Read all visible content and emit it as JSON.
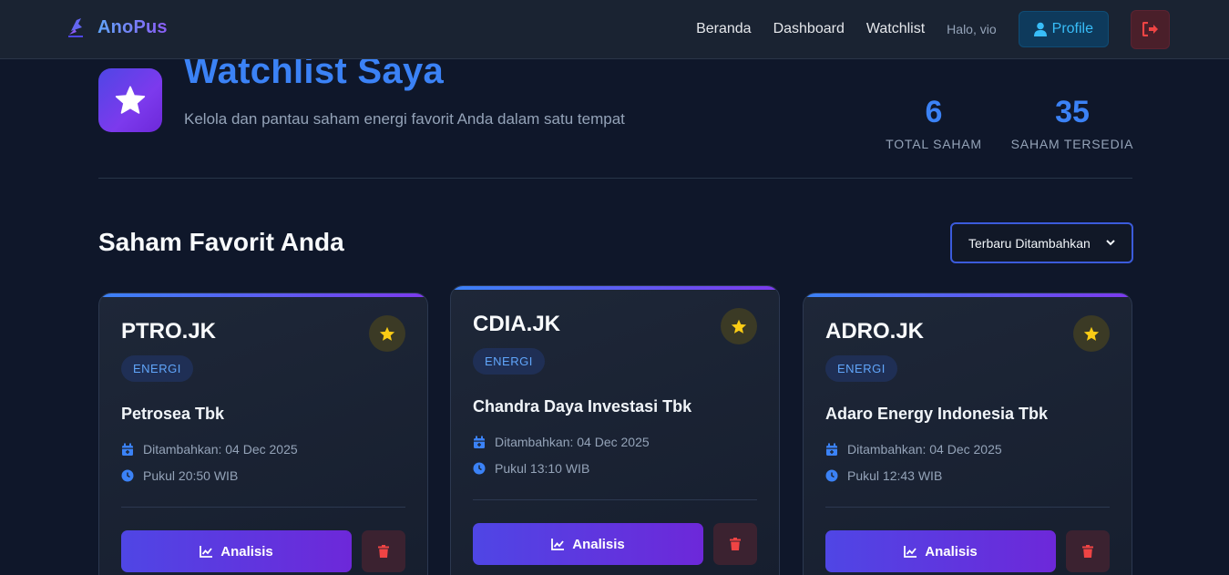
{
  "nav": {
    "brand": "AnoPus",
    "links": [
      "Beranda",
      "Dashboard",
      "Watchlist"
    ],
    "greeting": "Halo, vio",
    "profile_label": "Profile"
  },
  "header": {
    "title": "Watchlist Saya",
    "subtitle": "Kelola dan pantau saham energi favorit Anda dalam satu tempat",
    "stats": [
      {
        "value": "6",
        "label": "TOTAL SAHAM"
      },
      {
        "value": "35",
        "label": "SAHAM TERSEDIA"
      }
    ]
  },
  "section": {
    "title": "Saham Favorit Anda",
    "sort_selected": "Terbaru Ditambahkan"
  },
  "cards": [
    {
      "ticker": "PTRO.JK",
      "sector": "ENERGI",
      "company": "Petrosea Tbk",
      "added": "Ditambahkan: 04 Dec 2025",
      "time": "Pukul 20:50 WIB",
      "action": "Analisis"
    },
    {
      "ticker": "CDIA.JK",
      "sector": "ENERGI",
      "company": "Chandra Daya Investasi Tbk",
      "added": "Ditambahkan: 04 Dec 2025",
      "time": "Pukul 13:10 WIB",
      "action": "Analisis"
    },
    {
      "ticker": "ADRO.JK",
      "sector": "ENERGI",
      "company": "Adaro Energy Indonesia Tbk",
      "added": "Ditambahkan: 04 Dec 2025",
      "time": "Pukul 12:43 WIB",
      "action": "Analisis"
    }
  ],
  "colors": {
    "accent": "#3b82f6",
    "gradient_start": "#4f46e5",
    "gradient_end": "#7c3aed",
    "star": "#facc15",
    "danger": "#ef4444"
  },
  "icons": {
    "brand": "anopus-logo-icon",
    "profile": "user-icon",
    "logout": "sign-out-icon",
    "hero": "star-icon",
    "favorite": "star-icon",
    "date": "calendar-icon",
    "time": "clock-icon",
    "analysis": "chart-line-icon",
    "delete": "trash-icon"
  }
}
